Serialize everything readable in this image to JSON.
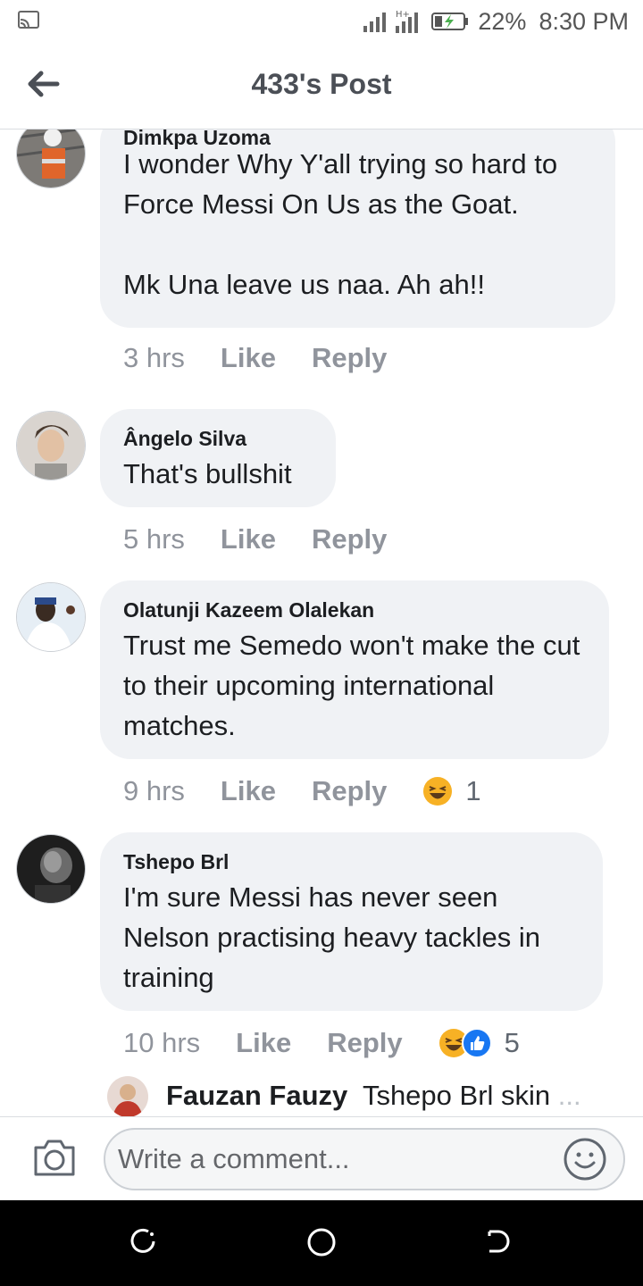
{
  "status_bar": {
    "battery": "22%",
    "time": "8:30 PM",
    "network": "H+"
  },
  "header": {
    "title": "433's Post"
  },
  "comments": [
    {
      "author": "Dimkpa Uzoma",
      "text": "I wonder Why Y'all trying so hard to Force Messi On Us as the Goat.\n\nMk Una leave us naa. Ah ah!!",
      "time": "3 hrs",
      "like": "Like",
      "reply": "Reply"
    },
    {
      "author": "Ângelo Silva",
      "text": "That's bullshit",
      "time": "5 hrs",
      "like": "Like",
      "reply": "Reply"
    },
    {
      "author": "Olatunji Kazeem Olalekan",
      "text": "Trust me Semedo won't make the cut to their upcoming international matches.",
      "time": "9 hrs",
      "like": "Like",
      "reply": "Reply",
      "reaction_count": "1",
      "reactions": [
        "haha"
      ]
    },
    {
      "author": "Tshepo Brl",
      "text": "I'm sure Messi has never seen Nelson practising heavy tackles in training",
      "time": "10 hrs",
      "like": "Like",
      "reply": "Reply",
      "reaction_count": "5",
      "reactions": [
        "haha",
        "like"
      ]
    }
  ],
  "reply_preview": {
    "author": "Fauzan Fauzy",
    "text": "Tshepo Brl skin",
    "ellipsis": "..."
  },
  "composer": {
    "placeholder": "Write a comment..."
  },
  "colors": {
    "bubble": "#f0f2f5",
    "meta": "#90949c",
    "like_blue": "#1877f2",
    "haha_yellow": "#f7b125"
  },
  "icons": [
    "cast-icon",
    "signal-icon",
    "battery-charging-icon",
    "back-arrow-icon",
    "camera-icon",
    "emoji-icon",
    "haha-reaction-icon",
    "like-reaction-icon",
    "recent-apps-icon",
    "home-icon",
    "back-nav-icon"
  ]
}
